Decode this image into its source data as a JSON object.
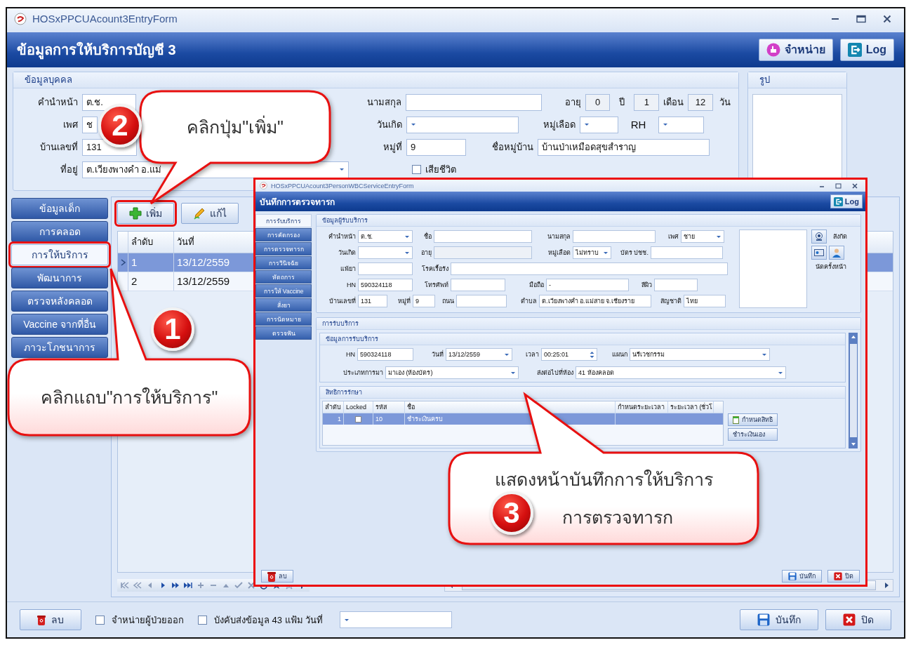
{
  "window": {
    "title": "HOSxPPCUAcount3EntryForm"
  },
  "header": {
    "title": "ข้อมูลการให้บริการบัญชี 3",
    "buttons": [
      {
        "label": "จำหน่าย",
        "kind": "discharge"
      },
      {
        "label": "Log",
        "kind": "log"
      }
    ]
  },
  "person": {
    "title": "ข้อมูลบุคคล",
    "prefix": {
      "label": "คำนำหน้า",
      "value": "ต.ช."
    },
    "sex": {
      "label": "เพศ",
      "value": "ช"
    },
    "house_no": {
      "label": "บ้านเลขที่",
      "value": "131"
    },
    "address": {
      "label": "ที่อยู่",
      "value": "ต.เวียงพางคำ อ.แม่"
    },
    "surname": {
      "label": "นามสกุล"
    },
    "birth_date": {
      "label": "วันเกิด"
    },
    "moo": {
      "label": "หมู่ที่",
      "value": "9"
    },
    "deceased": {
      "label": "เสียชีวิต",
      "checked": false
    },
    "age_label": "อายุ",
    "age": [
      {
        "value": "0",
        "unit": "ปี"
      },
      {
        "value": "1",
        "unit": "เดือน"
      },
      {
        "value": "12",
        "unit": "วัน"
      }
    ],
    "blood_group": {
      "label": "หมู่เลือด"
    },
    "rh": {
      "label": "RH"
    },
    "village": {
      "label": "ชื่อหมู่บ้าน",
      "value": "บ้านป่าเหมือดสุขสำราญ"
    }
  },
  "photo": {
    "title": "รูป"
  },
  "nav": [
    {
      "label": "ข้อมูลเด็ก",
      "selected": false,
      "highlighted": false
    },
    {
      "label": "การคลอด",
      "selected": false,
      "highlighted": false
    },
    {
      "label": "การให้บริการ",
      "selected": true,
      "highlighted": true
    },
    {
      "label": "พัฒนาการ",
      "selected": false,
      "highlighted": false
    },
    {
      "label": "ตรวจหลังคลอด",
      "selected": false,
      "highlighted": false
    },
    {
      "label": "Vaccine จากที่อื่น",
      "selected": false,
      "highlighted": false
    },
    {
      "label": "ภาวะโภชนาการ",
      "selected": false,
      "highlighted": false
    }
  ],
  "toolbar": [
    {
      "label": "เพิ่ม",
      "kind": "add",
      "highlighted": true
    },
    {
      "label": "แก้ไ",
      "kind": "edit",
      "highlighted": false
    }
  ],
  "grid": {
    "columns": [
      "ลำดับ",
      "วันที่"
    ],
    "rows": [
      {
        "cells": [
          "1",
          "13/12/2559"
        ],
        "selected": true
      },
      {
        "cells": [
          "2",
          "13/12/2559"
        ],
        "selected": false
      }
    ]
  },
  "bottom": {
    "delete": "ลบ",
    "checkboxes": [
      {
        "label": "จำหน่ายผู้ป่วยออก",
        "checked": false
      },
      {
        "label": "บังคับส่งข้อมูล 43 แฟ้ม วันที่",
        "checked": false
      }
    ],
    "save": "บันทึก",
    "close": "ปิด"
  },
  "dialog": {
    "title": "HOSxPPCUAcount3PersonWBCServiceEntryForm",
    "header": "บันทึกการตรวจทารก",
    "log": "Log",
    "tabs": [
      {
        "label": "การรับบริการ",
        "selected": true
      },
      {
        "label": "การคัดกรอง",
        "selected": false
      },
      {
        "label": "การตรวจทารก",
        "selected": false
      },
      {
        "label": "การวินิจฉัย",
        "selected": false
      },
      {
        "label": "หัตถการ",
        "selected": false
      },
      {
        "label": "การให้ Vaccine",
        "selected": false
      },
      {
        "label": "สั่งยา",
        "selected": false
      },
      {
        "label": "การนัดหมาย",
        "selected": false
      },
      {
        "label": "ตรวจฟัน",
        "selected": false
      }
    ],
    "patient": {
      "title": "ข้อมูลผู้รับบริการ",
      "rows": [
        {
          "fields": [
            {
              "label": "คำนำหน้า",
              "value": "ต.ช.",
              "kind": "dropdown"
            },
            {
              "label": "ชื่อ",
              "kind": "text"
            },
            {
              "label": "นามสกุล",
              "kind": "text"
            },
            {
              "label": "เพศ",
              "value": "ชาย",
              "kind": "dropdown"
            }
          ]
        },
        {
          "fields": [
            {
              "label": "วันเกิด",
              "kind": "dropdown"
            },
            {
              "label": "อายุ",
              "kind": "readonly"
            },
            {
              "label": "หมู่เลือด",
              "value": "ไม่ทราบ",
              "kind": "dropdown"
            },
            {
              "label": "บัตร ปชช.",
              "kind": "text"
            }
          ]
        },
        {
          "fields": [
            {
              "label": "แพ้ยา",
              "kind": "text"
            },
            {
              "label": "โรคเรื้อรัง",
              "kind": "text"
            }
          ]
        },
        {
          "fields": [
            {
              "label": "HN",
              "value": "590324118",
              "kind": "text"
            },
            {
              "label": "โทรศัพท์",
              "kind": "text"
            },
            {
              "label": "มือถือ",
              "value": "-",
              "kind": "text"
            },
            {
              "label": "สีผิว",
              "kind": "text"
            }
          ]
        },
        {
          "fields": [
            {
              "label": "บ้านเลขที่",
              "value": "131",
              "kind": "text"
            },
            {
              "label": "หมู่ที่",
              "value": "9",
              "kind": "text"
            },
            {
              "label": "ถนน",
              "kind": "text"
            },
            {
              "label": "ตำบล",
              "value": "ต.เวียงพางคำ อ.แม่สาย จ.เชียงราย",
              "kind": "text"
            },
            {
              "label": "สัญชาติ",
              "value": "ไทย",
              "kind": "text"
            }
          ]
        }
      ],
      "affiliation": "สังกัด",
      "next_appointment": "นัดครั้งหน้า"
    },
    "service": {
      "title": "การรับบริการ",
      "subtitle": "ข้อมูลการรับบริการ",
      "rows": [
        {
          "fields": [
            {
              "label": "HN",
              "value": "590324118",
              "kind": "text"
            },
            {
              "label": "วันที่",
              "value": "13/12/2559",
              "kind": "dropdown"
            },
            {
              "label": "เวลา",
              "value": "00:25:01",
              "kind": "spinner"
            },
            {
              "label": "แผนก",
              "value": "นรีเวชกรรม",
              "kind": "dropdown"
            }
          ]
        },
        {
          "fields": [
            {
              "label": "ประเภทการมา",
              "value": "มาเอง (ห้องบัตร)",
              "kind": "dropdown"
            },
            {
              "label": "ส่งต่อไปที่ห้อง",
              "value": "41 ห้องคลอด",
              "kind": "dropdown"
            }
          ]
        }
      ]
    },
    "rights": {
      "title": "สิทธิการรักษา",
      "columns": [
        "ลำดับ",
        "Locked",
        "รหัส",
        "ชื่อ",
        "กำหนดระยะเวลา",
        "ระยะเวลา (ชั่วโ"
      ],
      "rows": [
        {
          "number": "1",
          "locked": false,
          "code": "10",
          "name": "ชำระเงินครบ",
          "selected": true
        }
      ],
      "buttons": [
        "กำหนดสิทธิ",
        "ชำระเงินเอง"
      ]
    },
    "delete": "ลบ",
    "save": "บันทึก",
    "close": "ปิด"
  },
  "callouts": [
    {
      "number": "1",
      "lines": [
        "คลิกแถบ\"การให้บริการ\""
      ]
    },
    {
      "number": "2",
      "lines": [
        "คลิกปุ่ม\"เพิ่ม\""
      ]
    },
    {
      "number": "3",
      "lines": [
        "แสดงหน้าบันทึกการให้บริการ",
        "การตรวจทารก"
      ]
    }
  ]
}
